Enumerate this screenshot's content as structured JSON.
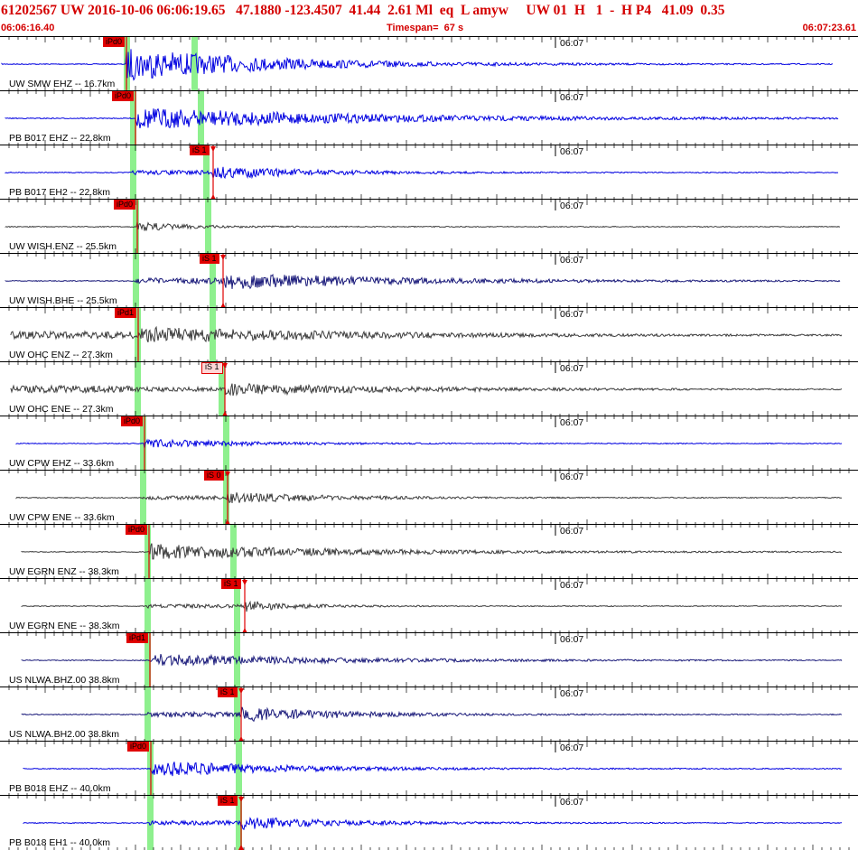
{
  "header": {
    "event_line": "61202567 UW 2016-10-06 06:06:19.65   47.1880 -123.4507  41.44  2.61 Ml  eq  L amyw     UW 01  H   1  -  H P4   41.09  0.35",
    "start_time": "06:06:16.40",
    "timespan": "Timespan=  67 s",
    "end_time": "06:07:23.61"
  },
  "colors": {
    "header_text": "#d40000",
    "trace_blue": "#0000e0",
    "trace_navy": "#1a1a7a",
    "trace_gray": "#3c3c3c",
    "pick_red": "#e00000",
    "arrival_band": "#8ef08e"
  },
  "panels": [
    {
      "label": "UW SMW EHZ -- 16.7km",
      "time_label": "06:07",
      "pick": "iPd0",
      "pick_kind": "P",
      "color": "trace_blue"
    },
    {
      "label": "PB B017 EHZ -- 22.8km",
      "time_label": "06:07",
      "pick": "iPd0",
      "pick_kind": "P",
      "color": "trace_blue"
    },
    {
      "label": "PB B017 EH2 -- 22.8km",
      "time_label": "06:07",
      "pick": "iS 1",
      "pick_kind": "S",
      "color": "trace_blue"
    },
    {
      "label": "UW WISH.ENZ -- 25.5km",
      "time_label": "06:07",
      "pick": "iPd0",
      "pick_kind": "P",
      "color": "trace_gray"
    },
    {
      "label": "UW WISH.BHE -- 25.5km",
      "time_label": "06:07",
      "pick": "iS 1",
      "pick_kind": "S",
      "color": "trace_navy"
    },
    {
      "label": "UW OHC ENZ -- 27.3km",
      "time_label": "06:07",
      "pick": "iPd1",
      "pick_kind": "P",
      "color": "trace_gray"
    },
    {
      "label": "UW OHC ENE -- 27.3km",
      "time_label": "06:07",
      "pick": "iS 1",
      "pick_kind": "S-light",
      "color": "trace_gray"
    },
    {
      "label": "UW CPW EHZ -- 33.6km",
      "time_label": "06:07",
      "pick": "iPd0",
      "pick_kind": "P",
      "color": "trace_blue"
    },
    {
      "label": "UW CPW ENE -- 33.6km",
      "time_label": "06:07",
      "pick": "iS 0",
      "pick_kind": "S",
      "color": "trace_gray"
    },
    {
      "label": "UW EGRN ENZ -- 38.3km",
      "time_label": "06:07",
      "pick": "iPd0",
      "pick_kind": "P",
      "color": "trace_gray"
    },
    {
      "label": "UW EGRN ENE -- 38.3km",
      "time_label": "06:07",
      "pick": "iS 1",
      "pick_kind": "S",
      "color": "trace_gray"
    },
    {
      "label": "US NLWA.BHZ.00 38.8km",
      "time_label": "06:07",
      "pick": "iPd1",
      "pick_kind": "P",
      "color": "trace_navy"
    },
    {
      "label": "US NLWA.BH2.00 38.8km",
      "time_label": "06:07",
      "pick": "iS 1",
      "pick_kind": "S",
      "color": "trace_navy"
    },
    {
      "label": "PB B018 EHZ -- 40.0km",
      "time_label": "06:07",
      "pick": "iPd0",
      "pick_kind": "P",
      "color": "trace_blue"
    },
    {
      "label": "PB B018 EH1 -- 40.0km",
      "time_label": "06:07",
      "pick": "iS 1",
      "pick_kind": "S",
      "color": "trace_blue"
    }
  ]
}
